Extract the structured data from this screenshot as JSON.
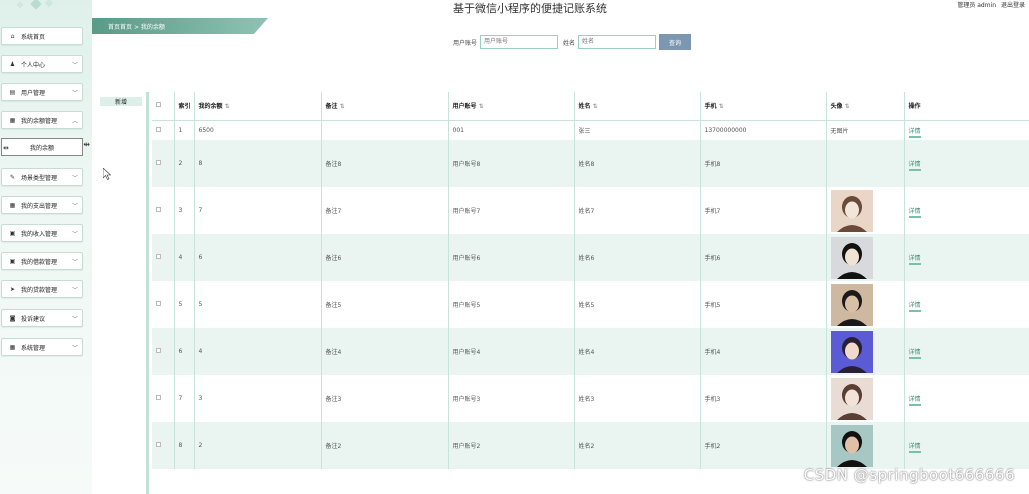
{
  "header": {
    "title": "基于微信小程序的便捷记账系统",
    "user_label": "管理员 admin",
    "logout_label": "退出登录"
  },
  "breadcrumb": {
    "home": "首页首页",
    "separator": ">",
    "current": "我的余额"
  },
  "search": {
    "account_label": "用户账号",
    "account_placeholder": "用户账号",
    "name_label": "姓名",
    "name_placeholder": "姓名",
    "button_label": "查询"
  },
  "sidebar": {
    "items": [
      {
        "label": "系统首页",
        "icon": "home-icon"
      },
      {
        "label": "个人中心",
        "icon": "user-icon"
      },
      {
        "label": "用户管理",
        "icon": "users-icon"
      },
      {
        "label": "我的余额管理",
        "icon": "grid-icon"
      },
      {
        "label": "场景类型管理",
        "icon": "edit-icon"
      },
      {
        "label": "我的支出管理",
        "icon": "grid-icon"
      },
      {
        "label": "我的收入管理",
        "icon": "clipboard-icon"
      },
      {
        "label": "我的借款管理",
        "icon": "clipboard-icon"
      },
      {
        "label": "我的贷款管理",
        "icon": "send-icon"
      },
      {
        "label": "投诉建议",
        "icon": "camera-icon"
      },
      {
        "label": "系统管理",
        "icon": "grid-icon"
      }
    ],
    "submenu_label": "我的余额"
  },
  "actions": {
    "add_label": "新增"
  },
  "table": {
    "headers": [
      "索引",
      "我的余额",
      "备注",
      "用户账号",
      "姓名",
      "手机",
      "头像",
      "操作"
    ],
    "rows": [
      {
        "index": "1",
        "balance": "6500",
        "note": "",
        "account": "001",
        "name": "张三",
        "phone": "13700000000",
        "avatar": "无图片",
        "action": "详情"
      },
      {
        "index": "2",
        "balance": "8",
        "note": "备注8",
        "account": "用户账号8",
        "name": "姓名8",
        "phone": "手机8",
        "avatar": "",
        "action": "详情"
      },
      {
        "index": "3",
        "balance": "7",
        "note": "备注7",
        "account": "用户账号7",
        "name": "姓名7",
        "phone": "手机7",
        "avatar": "photo",
        "action": "详情"
      },
      {
        "index": "4",
        "balance": "6",
        "note": "备注6",
        "account": "用户账号6",
        "name": "姓名6",
        "phone": "手机6",
        "avatar": "photo",
        "action": "详情"
      },
      {
        "index": "5",
        "balance": "5",
        "note": "备注5",
        "account": "用户账号5",
        "name": "姓名5",
        "phone": "手机5",
        "avatar": "photo",
        "action": "详情"
      },
      {
        "index": "6",
        "balance": "4",
        "note": "备注4",
        "account": "用户账号4",
        "name": "姓名4",
        "phone": "手机4",
        "avatar": "photo",
        "action": "详情"
      },
      {
        "index": "7",
        "balance": "3",
        "note": "备注3",
        "account": "用户账号3",
        "name": "姓名3",
        "phone": "手机3",
        "avatar": "photo",
        "action": "详情"
      },
      {
        "index": "8",
        "balance": "2",
        "note": "备注2",
        "account": "用户账号2",
        "name": "姓名2",
        "phone": "手机2",
        "avatar": "photo",
        "action": "详情"
      }
    ]
  },
  "watermark": "CSDN @springboot666666",
  "colors": {
    "accent": "#5a9a86",
    "row_alt": "#eaf5f1",
    "search_button": "#7b97b2",
    "sidebar_bg": "#dff0ea"
  }
}
